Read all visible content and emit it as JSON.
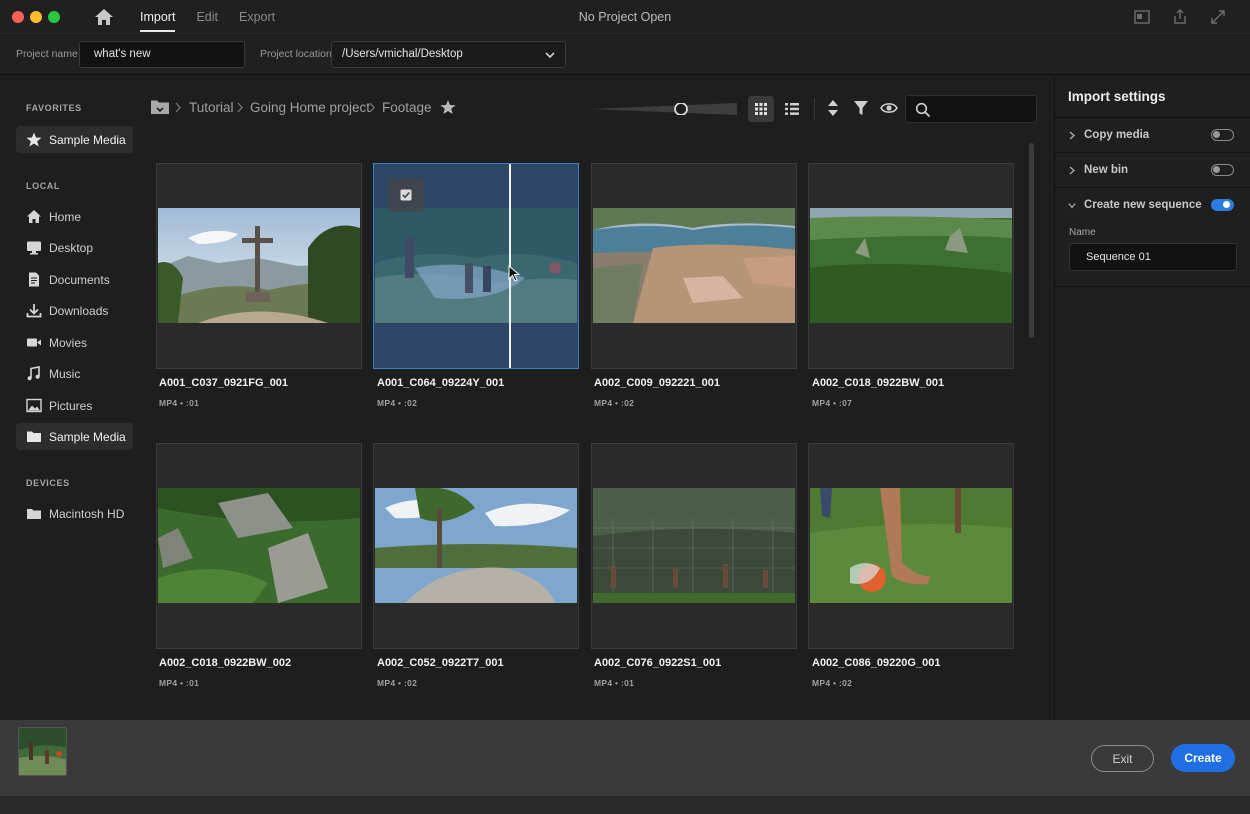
{
  "window": {
    "title": "No Project Open"
  },
  "tabs": [
    {
      "label": "Import",
      "active": true
    },
    {
      "label": "Edit",
      "active": false
    },
    {
      "label": "Export",
      "active": false
    }
  ],
  "project": {
    "name_label": "Project name",
    "name_value": "what's new",
    "location_label": "Project location",
    "location_value": "/Users/vmichal/Desktop"
  },
  "sidebar": {
    "favorites_heading": "FAVORITES",
    "favorites": [
      {
        "label": "Sample Media",
        "icon": "star-icon"
      }
    ],
    "local_heading": "LOCAL",
    "local": [
      {
        "label": "Home",
        "icon": "home-icon"
      },
      {
        "label": "Desktop",
        "icon": "desktop-icon"
      },
      {
        "label": "Documents",
        "icon": "document-icon"
      },
      {
        "label": "Downloads",
        "icon": "download-icon"
      },
      {
        "label": "Movies",
        "icon": "movie-icon"
      },
      {
        "label": "Music",
        "icon": "music-icon"
      },
      {
        "label": "Pictures",
        "icon": "picture-icon"
      },
      {
        "label": "Sample Media",
        "icon": "folder-icon",
        "selected": true
      }
    ],
    "devices_heading": "DEVICES",
    "devices": [
      {
        "label": "Macintosh HD",
        "icon": "drive-icon"
      }
    ]
  },
  "breadcrumb": [
    "Tutorial",
    "Going Home project",
    "Footage"
  ],
  "search": {
    "placeholder": "",
    "value": ""
  },
  "clips": [
    {
      "name": "A001_C037_0921FG_001",
      "meta": "MP4 • :01"
    },
    {
      "name": "A001_C064_09224Y_001",
      "meta": "MP4 • :02",
      "selected": true
    },
    {
      "name": "A002_C009_092221_001",
      "meta": "MP4 • :02"
    },
    {
      "name": "A002_C018_0922BW_001",
      "meta": "MP4 • :07"
    },
    {
      "name": "A002_C018_0922BW_002",
      "meta": "MP4 • :01"
    },
    {
      "name": "A002_C052_0922T7_001",
      "meta": "MP4 • :02"
    },
    {
      "name": "A002_C076_0922S1_001",
      "meta": "MP4 • :01"
    },
    {
      "name": "A002_C086_09220G_001",
      "meta": "MP4 • :02"
    }
  ],
  "import_settings": {
    "title": "Import settings",
    "copy_media": {
      "label": "Copy media",
      "on": false
    },
    "new_bin": {
      "label": "New bin",
      "on": false
    },
    "create_sequence": {
      "label": "Create new sequence",
      "on": true
    },
    "name_label": "Name",
    "name_value": "Sequence 01"
  },
  "footer": {
    "exit_label": "Exit",
    "create_label": "Create"
  },
  "colors": {
    "accent": "#1f6fe2",
    "selection": "#3f7fd0"
  }
}
